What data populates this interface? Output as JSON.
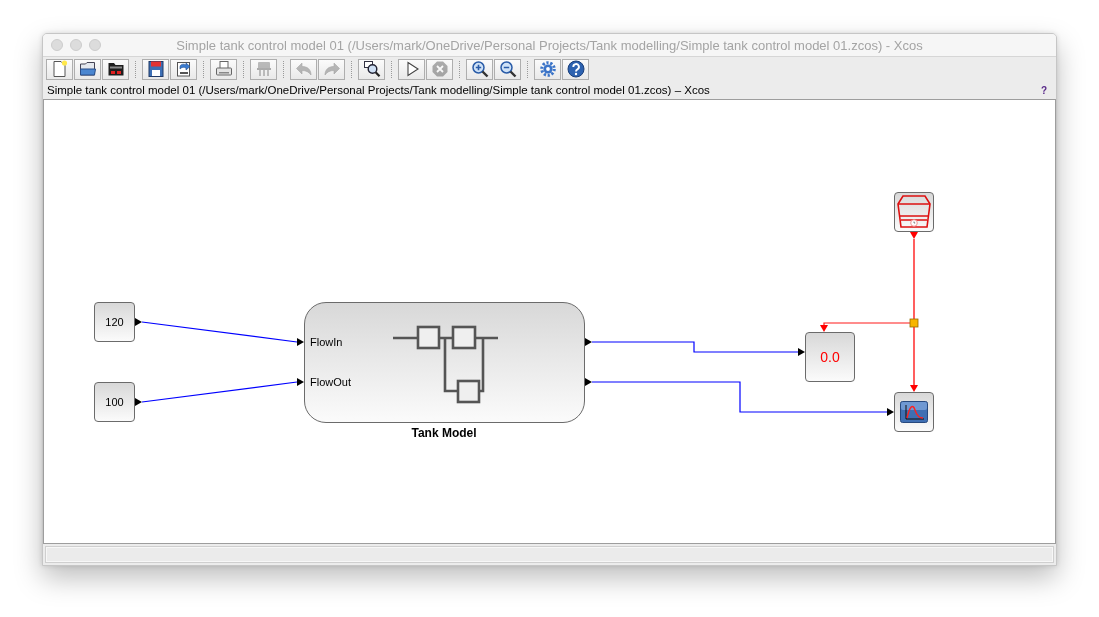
{
  "window": {
    "title": "Simple tank control model 01 (/Users/mark/OneDrive/Personal Projects/Tank modelling/Simple tank control model 01.zcos) - Xcos"
  },
  "toolbar": {
    "groups": [
      [
        {
          "kind": "new",
          "disabled": false
        },
        {
          "kind": "open",
          "disabled": false
        },
        {
          "kind": "opendir",
          "disabled": false
        }
      ],
      [
        {
          "kind": "save",
          "disabled": false
        },
        {
          "kind": "saveas",
          "disabled": false
        }
      ],
      [
        {
          "kind": "print",
          "disabled": false
        }
      ],
      [
        {
          "kind": "delete",
          "disabled": true
        }
      ],
      [
        {
          "kind": "undo",
          "disabled": true
        },
        {
          "kind": "redo",
          "disabled": true
        }
      ],
      [
        {
          "kind": "fit",
          "disabled": false
        }
      ],
      [
        {
          "kind": "start",
          "disabled": false
        },
        {
          "kind": "stop",
          "disabled": true
        }
      ],
      [
        {
          "kind": "zoomin",
          "disabled": false
        },
        {
          "kind": "zoomout",
          "disabled": false
        }
      ],
      [
        {
          "kind": "setup",
          "disabled": false
        },
        {
          "kind": "help",
          "disabled": false
        }
      ]
    ]
  },
  "info_bar": {
    "path": "Simple tank control model 01 (/Users/mark/OneDrive/Personal Projects/Tank modelling/Simple tank control model 01.zcos) – Xcos",
    "help_mark": "?"
  },
  "diagram": {
    "constants": [
      {
        "value": "120"
      },
      {
        "value": "100"
      }
    ],
    "tank_model": {
      "inputs": [
        {
          "label": "FlowIn"
        },
        {
          "label": "FlowOut"
        }
      ],
      "caption": "Tank Model"
    },
    "display": {
      "value": "0.0"
    }
  }
}
